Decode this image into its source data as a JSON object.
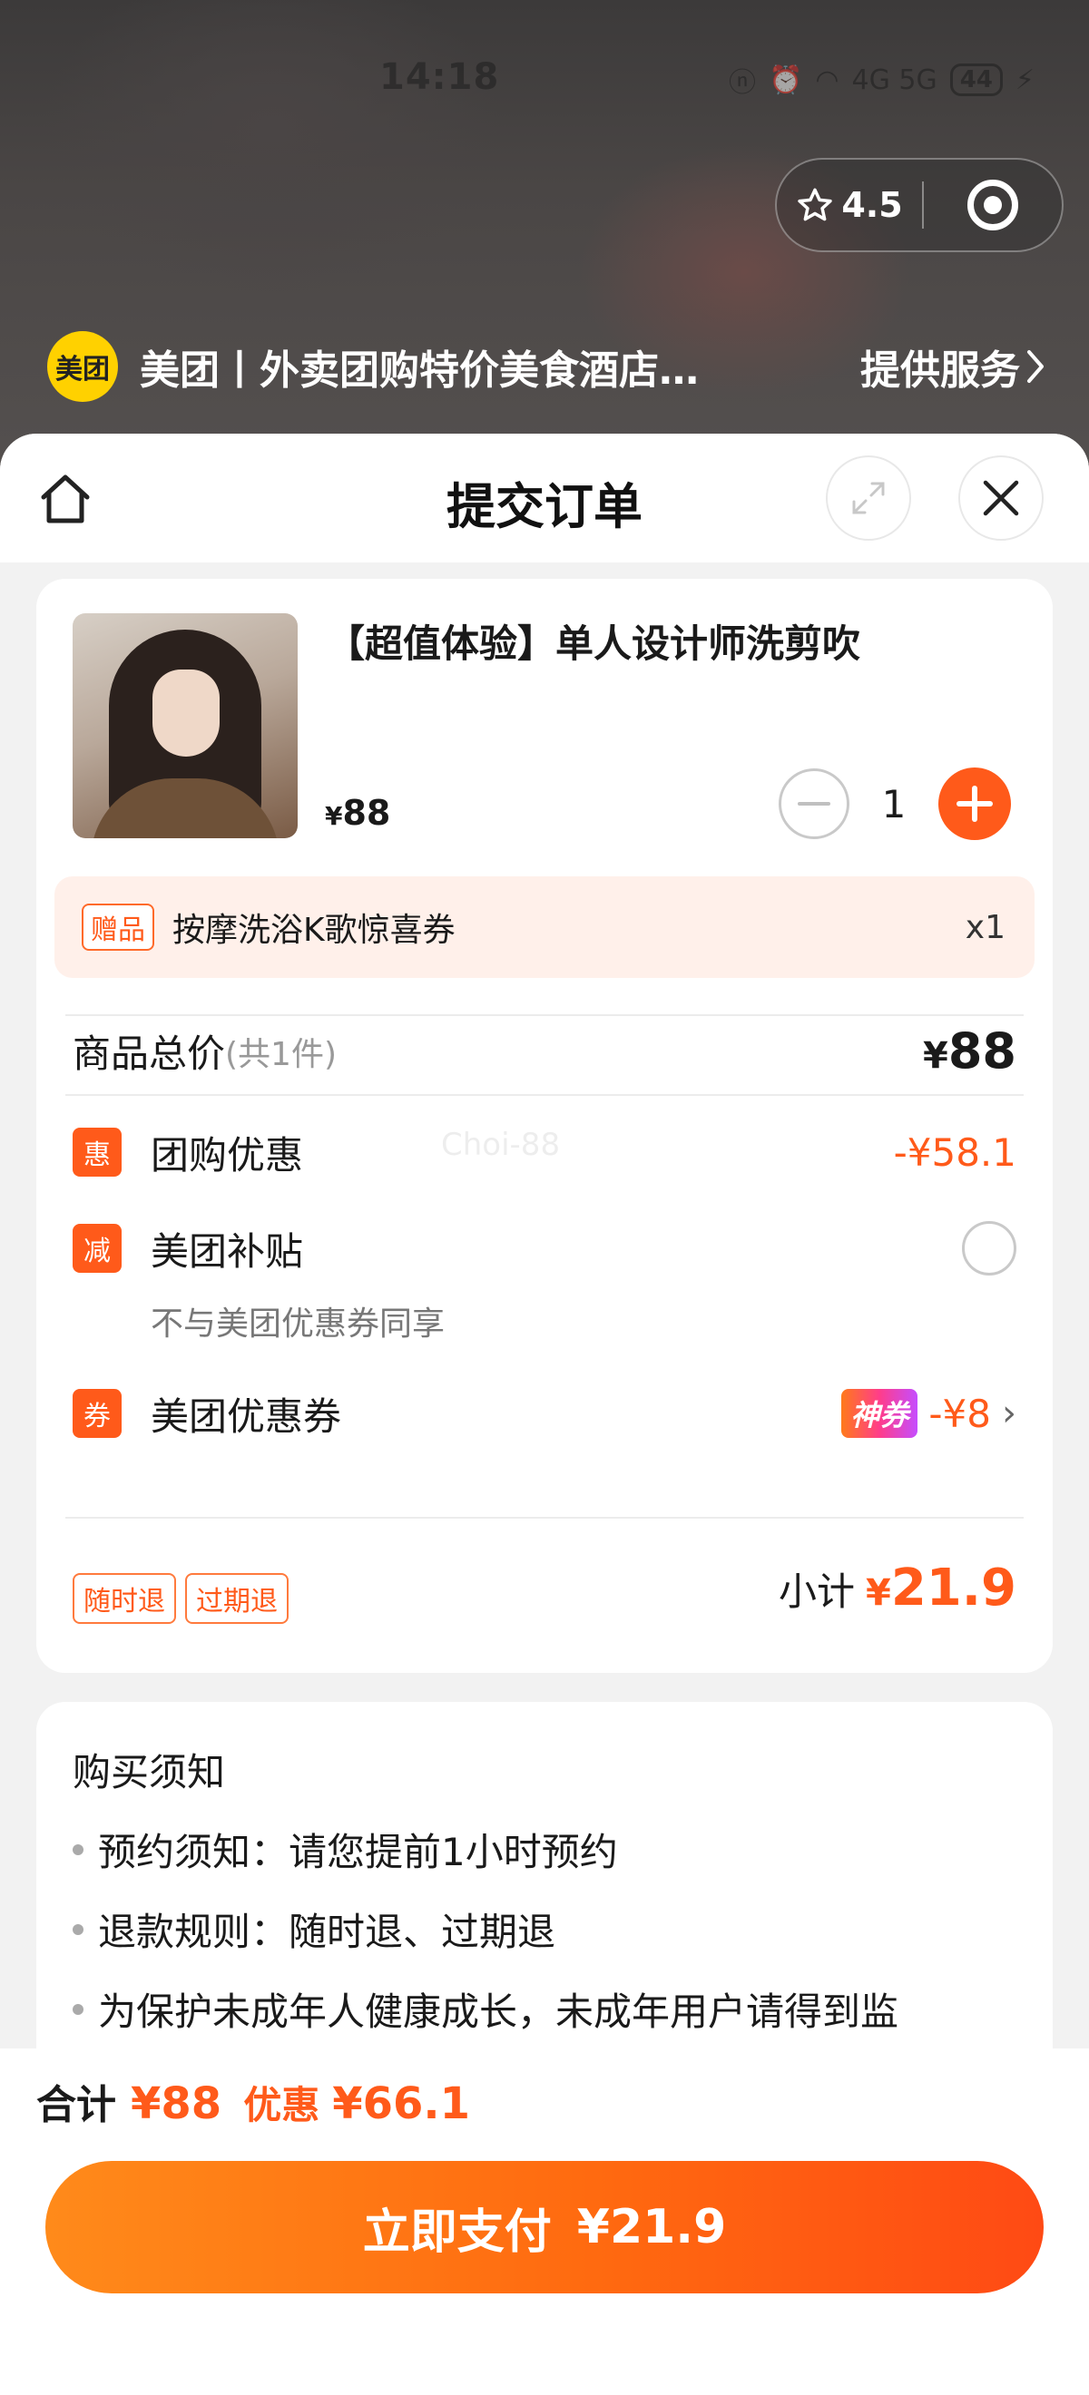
{
  "status_bar": {
    "time": "14:18",
    "signal_text": "4G 5G",
    "battery": "44"
  },
  "capsule": {
    "rating": "4.5"
  },
  "mini_program": {
    "logo_text": "美团",
    "title": "美团丨外卖团购特价美食酒店…",
    "service_link": "提供服务"
  },
  "sheet": {
    "title": "提交订单"
  },
  "product": {
    "name": "【超值体验】单人设计师洗剪吹",
    "price_symbol": "¥",
    "price": "88",
    "quantity": "1"
  },
  "gift": {
    "tag": "赠品",
    "name": "按摩洗浴K歌惊喜券",
    "qty": "x1"
  },
  "total": {
    "label": "商品总价",
    "count": "(共1件)",
    "symbol": "¥",
    "value": "88"
  },
  "watermark": "Choi-88",
  "discounts": [
    {
      "badge": "惠",
      "label": "团购优惠",
      "value": "-¥58.1"
    },
    {
      "badge": "减",
      "label": "美团补贴",
      "sub": "不与美团优惠券同享"
    },
    {
      "badge": "券",
      "label": "美团优惠券",
      "tag": "神券",
      "value": "-¥8"
    }
  ],
  "refund_tags": [
    "随时退",
    "过期退"
  ],
  "subtotal": {
    "label": "小计",
    "symbol": "¥",
    "value": "21.9"
  },
  "notice": {
    "title": "购买须知",
    "items": [
      "预约须知：请您提前1小时预约",
      "退款规则：随时退、过期退",
      "为保护未成年人健康成长，未成年用户请得到监"
    ]
  },
  "footer": {
    "sum_label": "合计",
    "sum_value": "¥88",
    "discount_label": "优惠",
    "discount_value": "¥66.1",
    "pay_label": "立即支付",
    "pay_amount": "¥21.9"
  },
  "colors": {
    "accent": "#ff5a1a",
    "gift_bg": "#fff0ea",
    "brand_yellow": "#ffd100"
  }
}
